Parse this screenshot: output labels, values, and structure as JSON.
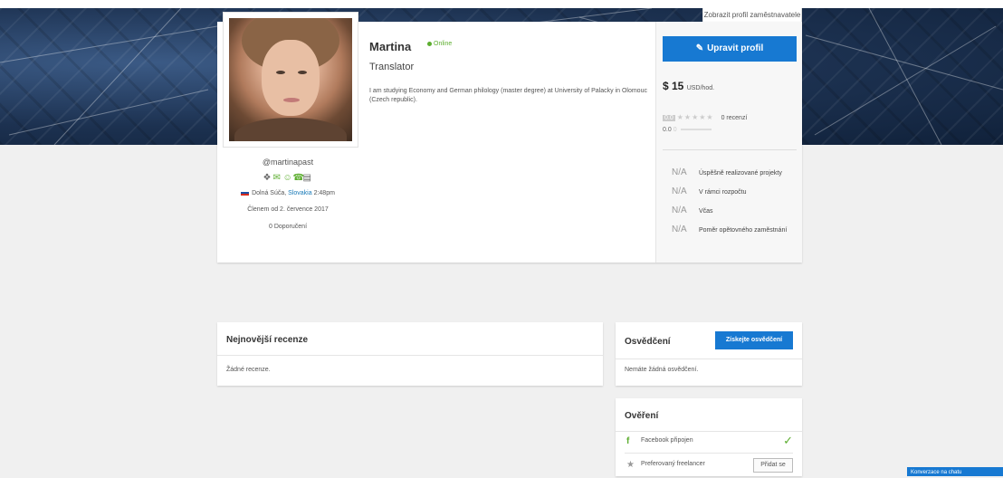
{
  "banner": {
    "view_employer_label": "Zobrazit profil zaměstnavatele"
  },
  "profile": {
    "name": "Martina",
    "status": "Online",
    "headline": "Translator",
    "description": "I am studying Economy and German philology (master degree) at University of Palacky in Olomouc (Czech republic).",
    "handle": "@martinapast",
    "location_city": "Dolná Súča,",
    "location_country": "Slovakia",
    "local_time": "2:48pm",
    "member_since": "Členem od 2. července 2017",
    "recommendations": "0 Doporučení",
    "verification_icons": [
      "shield-icon",
      "envelope-icon",
      "user-icon",
      "phone-icon",
      "card-icon"
    ]
  },
  "side_panel": {
    "edit_label": "Upravit profil",
    "rate_value": "$ 15",
    "rate_unit": "USD/hod.",
    "rating_score": "0.0",
    "rating_reviews": "0 recenzí",
    "rating_sub": "0.0",
    "rating_sub_count": "0",
    "stats": [
      {
        "value": "N/A",
        "label": "Úspěšně realizované projekty"
      },
      {
        "value": "N/A",
        "label": "V rámci rozpočtu"
      },
      {
        "value": "N/A",
        "label": "Včas"
      },
      {
        "value": "N/A",
        "label": "Poměr opětovného zaměstnání"
      }
    ]
  },
  "reviews": {
    "title": "Nejnovější recenze",
    "empty": "Žádné recenze."
  },
  "certifications": {
    "title": "Osvědčení",
    "button": "Získejte osvědčení",
    "empty": "Nemáte žádná osvědčení."
  },
  "verifications": {
    "title": "Ověření",
    "facebook": "Facebook připojen",
    "preferred": "Preferovaný freelancer",
    "join_button": "Přidat se"
  },
  "chat": {
    "label": "Konverzace na chatu"
  },
  "colors": {
    "accent": "#1779d2",
    "online": "#5dae30"
  }
}
